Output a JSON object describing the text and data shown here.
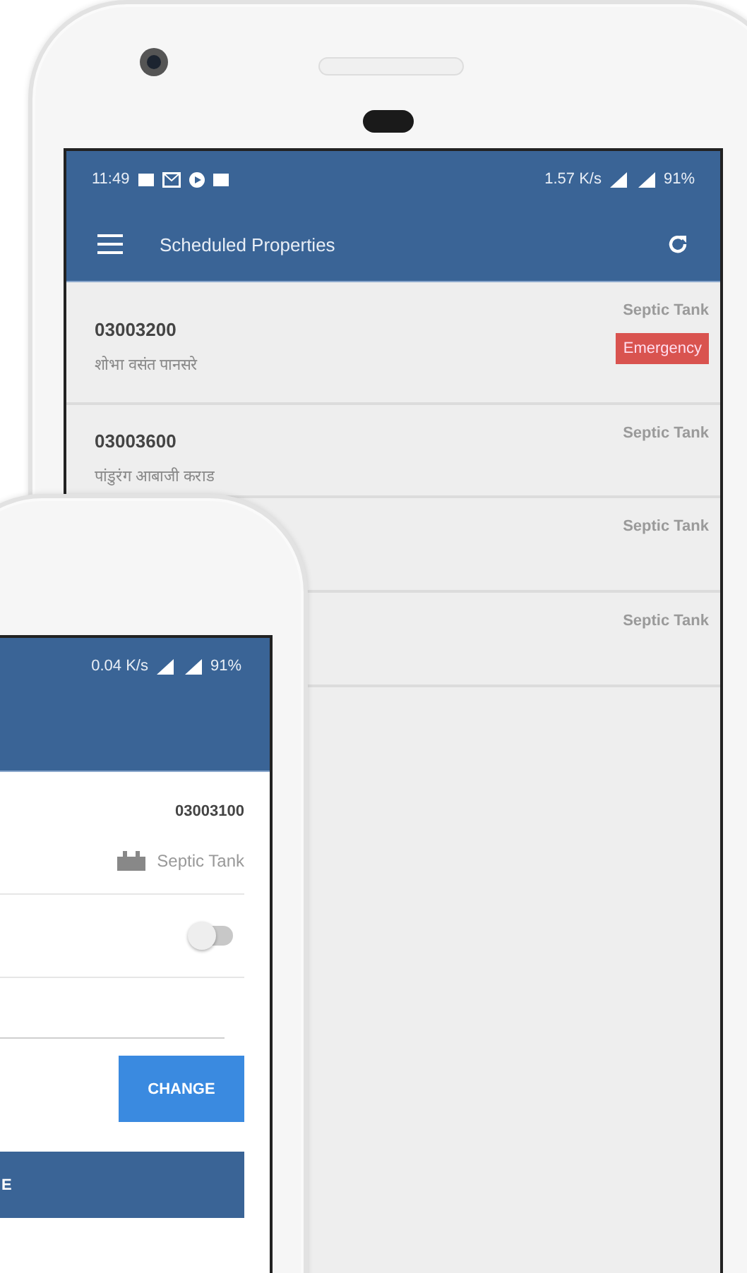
{
  "back_phone": {
    "status_bar": {
      "time": "11:49",
      "speed": "1.57 K/s",
      "battery": "91%"
    },
    "toolbar": {
      "title": "Scheduled Properties"
    },
    "rows": [
      {
        "id": "03003200",
        "name": "शोभा वसंत पानसरे",
        "type": "Septic Tank",
        "badge": "Emergency"
      },
      {
        "id": "03003600",
        "name": "पांडुरंग आबाजी कराड",
        "type": "Septic Tank"
      },
      {
        "type": "Septic Tank"
      },
      {
        "type": "Septic Tank"
      }
    ]
  },
  "front_phone": {
    "status_bar": {
      "speed": "0.04 K/s",
      "battery": "91%"
    },
    "detail": {
      "id": "03003100",
      "type": "Septic Tank",
      "toggle": {
        "on": false
      },
      "change_button": "CHANGE",
      "bottom_button": "E"
    }
  }
}
